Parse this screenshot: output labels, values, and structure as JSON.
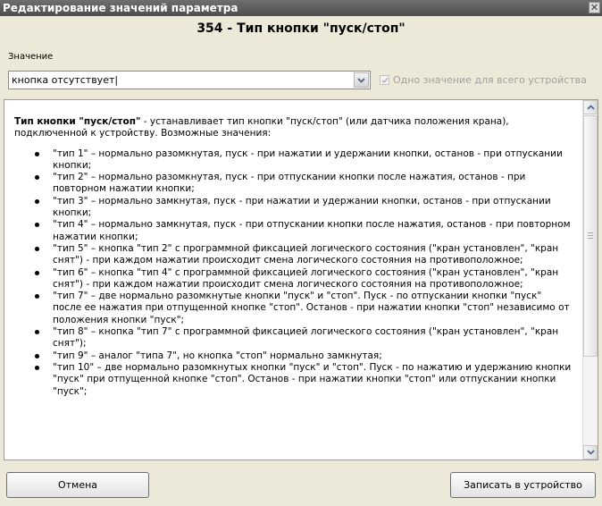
{
  "window": {
    "title": "Редактирование значений параметра",
    "close_glyph": "✕"
  },
  "parameter": {
    "title": "354 - Тип кнопки \"пуск/стоп\""
  },
  "value_field": {
    "label": "Значение",
    "selected": "кнопка отсутствует|",
    "dropdown_icon": "chevron-down-icon"
  },
  "checkbox": {
    "label": "Одно значение для всего устройства",
    "checked": true,
    "enabled": false
  },
  "description": {
    "intro_bold": "Тип кнопки \"пуск/стоп\"",
    "intro_rest": " - устанавливает тип кнопки \"пуск/стоп\" (или датчика положения крана), подключенной к устройству. Возможные значения:",
    "items": [
      "\"тип 1\" – нормально разомкнутая, пуск - при нажатии и удержании кнопки, останов - при отпускании кнопки;",
      "\"тип 2\" – нормально разомкнутая, пуск - при отпускании кнопки после нажатия, останов - при повторном нажатии кнопки;",
      "\"тип 3\" – нормально замкнутая, пуск - при нажатии и удержании кнопки, останов - при отпускании кнопки;",
      "\"тип 4\" – нормально замкнутая, пуск - при отпускании кнопки после нажатия, останов - при повторном нажатии кнопки;",
      "\"тип 5\" – кнопка \"тип 2\" с программной фиксацией логического состояния (\"кран установлен\", \"кран снят\") - при каждом нажатии происходит смена логического состояния на противоположное;",
      "\"тип 6\" – кнопка \"тип 4\" с программной фиксацией логического состояния (\"кран установлен\", \"кран снят\") - при каждом нажатии происходит смена логического состояния на противоположное;",
      "\"тип 7\" – две нормально разомкнутые кнопки \"пуск\" и \"стоп\". Пуск - по отпускании кнопки \"пуск\" после ее нажатия при отпущенной кнопке \"стоп\". Останов - при нажатии кнопки \"стоп\" независимо от положения кнопки \"пуск\";",
      "\"тип 8\" – кнопка \"тип 7\" с программной фиксацией логического состояния (\"кран установлен\", \"кран снят\");",
      "\"тип 9\" – аналог \"типа 7\", но кнопка \"стоп\" нормально замкнутая;",
      "\"тип 10\" – две нормально разомкнутых кнопки \"пуск\" и \"стоп\". Пуск - по нажатию и удержанию кнопки \"пуск\" при отпущенной кнопке \"стоп\". Останов - при нажатии кнопки \"стоп\" или отпускании кнопки \"пуск\";"
    ]
  },
  "buttons": {
    "cancel": "Отмена",
    "write": "Записать в устройство"
  },
  "colors": {
    "titlebar": "#5a5a5a",
    "dialog_bg": "#ece9d8",
    "disabled_text": "#a0a0a0"
  }
}
